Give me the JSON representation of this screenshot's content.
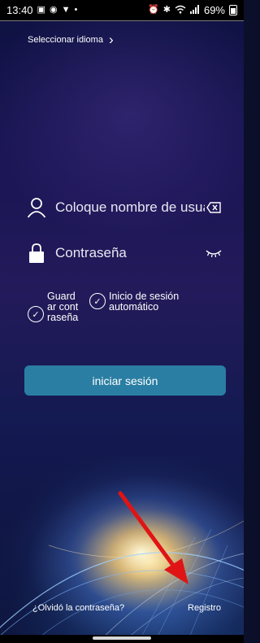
{
  "status_bar": {
    "time": "13:40",
    "battery": "69%",
    "icons_left": [
      "message-icon",
      "instagram-icon",
      "mail-icon",
      "dot-icon"
    ],
    "icons_right": [
      "alarm-icon",
      "bluetooth-icon",
      "wifi-icon",
      "signal-icon"
    ]
  },
  "language": {
    "label": "Seleccionar idioma"
  },
  "login_form": {
    "username_placeholder": "Coloque nombre de usuario",
    "password_placeholder": "Contraseña",
    "remember_label": "Guardar contraseña",
    "auto_login_label": "Inicio de sesión automático",
    "submit_label": "iniciar sesión"
  },
  "footer": {
    "forgot_label": "¿Olvidó la contraseña?",
    "register_label": "Registro"
  },
  "colors": {
    "button": "#2a7ea3",
    "annotation_arrow": "#e01414"
  }
}
